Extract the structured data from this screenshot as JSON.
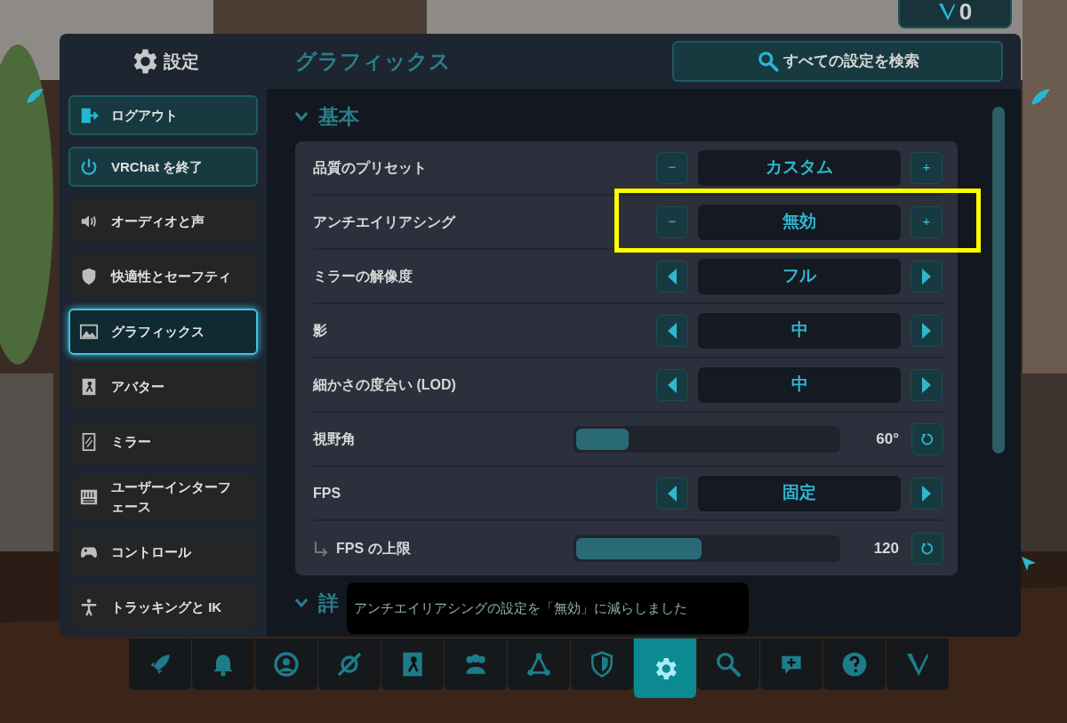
{
  "currency": {
    "amount": "0"
  },
  "sidebar": {
    "title": "設定",
    "items": [
      {
        "label": "ログアウト",
        "kind": "action"
      },
      {
        "label": "VRChat を終了",
        "kind": "action"
      },
      {
        "label": "オーディオと声",
        "kind": "category",
        "selected": false
      },
      {
        "label": "快適性とセーフティ",
        "kind": "category",
        "selected": false
      },
      {
        "label": "グラフィックス",
        "kind": "category",
        "selected": true
      },
      {
        "label": "アバター",
        "kind": "category",
        "selected": false
      },
      {
        "label": "ミラー",
        "kind": "category",
        "selected": false
      },
      {
        "label": "ユーザーインターフェース",
        "kind": "category",
        "selected": false
      },
      {
        "label": "コントロール",
        "kind": "category",
        "selected": false
      },
      {
        "label": "トラッキングと IK",
        "kind": "category",
        "selected": false
      }
    ]
  },
  "page_title": "グラフィックス",
  "search_button": "すべての設定を検索",
  "sections": [
    {
      "title": "基本",
      "rows": [
        {
          "label": "品質のプリセット",
          "kind": "stepper",
          "minus": "−",
          "value": "カスタム",
          "plus": "+",
          "highlighted": false
        },
        {
          "label": "アンチエイリアシング",
          "kind": "stepper",
          "minus": "−",
          "value": "無効",
          "plus": "+",
          "highlighted": true
        },
        {
          "label": "ミラーの解像度",
          "kind": "arrows",
          "value": "フル"
        },
        {
          "label": "影",
          "kind": "arrows",
          "value": "中"
        },
        {
          "label": "細かさの度合い (LOD)",
          "kind": "arrows",
          "value": "中"
        },
        {
          "label": "視野角",
          "kind": "slider",
          "level": 0.2,
          "reading": "60°"
        },
        {
          "label": "FPS",
          "kind": "arrows",
          "value": "固定",
          "children": [
            {
              "label": "FPS の上限",
              "kind": "slider",
              "level": 0.48,
              "reading": "120"
            }
          ]
        }
      ]
    },
    {
      "title": "詳"
    }
  ],
  "toast": "アンチエイリアシングの設定を「無効」に減らしました",
  "dock": [
    {
      "selected": false
    },
    {
      "selected": false
    },
    {
      "selected": false
    },
    {
      "selected": false
    },
    {
      "selected": false
    },
    {
      "selected": false
    },
    {
      "selected": false
    },
    {
      "selected": false
    },
    {
      "selected": true
    },
    {
      "selected": false
    },
    {
      "selected": false
    },
    {
      "selected": false
    },
    {
      "selected": false
    }
  ]
}
